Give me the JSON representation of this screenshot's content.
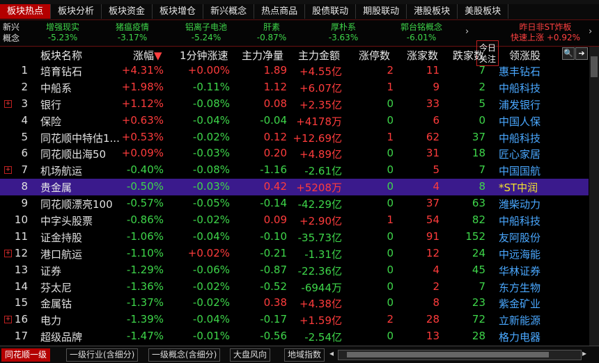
{
  "tabs": [
    {
      "label": "板块热点",
      "active": true
    },
    {
      "label": "板块分析"
    },
    {
      "label": "板块资金"
    },
    {
      "label": "板块增仓"
    },
    {
      "label": "新兴概念"
    },
    {
      "label": "热点商品"
    },
    {
      "label": "股债联动"
    },
    {
      "label": "期股联动"
    },
    {
      "label": "港股板块"
    },
    {
      "label": "美股板块"
    }
  ],
  "concept_bar": {
    "label": "新兴概念",
    "items": [
      {
        "name": "增强现实",
        "pct": "-5.23%"
      },
      {
        "name": "猪瘟疫情",
        "pct": "-3.17%"
      },
      {
        "name": "铝离子电池",
        "pct": "-5.24%"
      },
      {
        "name": "肝素",
        "pct": "-0.87%"
      },
      {
        "name": "厚朴系",
        "pct": "-3.63%"
      },
      {
        "name": "郭台铭概念",
        "pct": "-6.01%"
      }
    ],
    "today_label": "今日关注",
    "st_title": "昨日非ST炸板",
    "st_line": "快速上涨 +0.92%"
  },
  "columns": [
    "板块名称",
    "涨幅",
    "1分钟涨速",
    "主力净量",
    "主力金额",
    "涨停数",
    "涨家数",
    "跌家数",
    "领涨股"
  ],
  "sort_icon": "▼",
  "rows": [
    {
      "idx": "1",
      "name": "培育钻石",
      "pct": "+4.31%",
      "speed": "+0.00%",
      "net": "1.89",
      "amt": "+4.55亿",
      "zt": "2",
      "up": "11",
      "dn": "7",
      "lead": "惠丰钻石",
      "plus": false
    },
    {
      "idx": "2",
      "name": "中船系",
      "pct": "+1.98%",
      "speed": "-0.11%",
      "net": "1.12",
      "amt": "+6.07亿",
      "zt": "1",
      "up": "9",
      "dn": "2",
      "lead": "中船科技",
      "plus": false
    },
    {
      "idx": "3",
      "name": "银行",
      "pct": "+1.12%",
      "speed": "-0.08%",
      "net": "0.08",
      "amt": "+2.35亿",
      "zt": "0",
      "up": "33",
      "dn": "5",
      "lead": "浦发银行",
      "plus": true
    },
    {
      "idx": "4",
      "name": "保险",
      "pct": "+0.63%",
      "speed": "-0.04%",
      "net": "-0.04",
      "amt": "+4178万",
      "zt": "0",
      "up": "6",
      "dn": "0",
      "lead": "中国人保",
      "plus": false
    },
    {
      "idx": "5",
      "name": "同花顺中特估1...",
      "pct": "+0.53%",
      "speed": "-0.02%",
      "net": "0.12",
      "amt": "+12.69亿",
      "zt": "1",
      "up": "62",
      "dn": "37",
      "lead": "中船科技",
      "plus": false
    },
    {
      "idx": "6",
      "name": "同花顺出海50",
      "pct": "+0.09%",
      "speed": "-0.03%",
      "net": "0.20",
      "amt": "+4.89亿",
      "zt": "0",
      "up": "31",
      "dn": "18",
      "lead": "匠心家居",
      "plus": false
    },
    {
      "idx": "7",
      "name": "机场航运",
      "pct": "-0.40%",
      "speed": "-0.08%",
      "net": "-1.16",
      "amt": "-2.61亿",
      "zt": "0",
      "up": "5",
      "dn": "7",
      "lead": "中国国航",
      "plus": true
    },
    {
      "idx": "8",
      "name": "贵金属",
      "pct": "-0.50%",
      "speed": "-0.03%",
      "net": "0.42",
      "amt": "+5208万",
      "zt": "0",
      "up": "4",
      "dn": "8",
      "lead": "*ST中润",
      "plus": false,
      "selected": true
    },
    {
      "idx": "9",
      "name": "同花顺漂亮100",
      "pct": "-0.57%",
      "speed": "-0.05%",
      "net": "-0.14",
      "amt": "-42.29亿",
      "zt": "0",
      "up": "37",
      "dn": "63",
      "lead": "潍柴动力",
      "plus": false
    },
    {
      "idx": "10",
      "name": "中字头股票",
      "pct": "-0.86%",
      "speed": "-0.02%",
      "net": "0.09",
      "amt": "+2.90亿",
      "zt": "1",
      "up": "54",
      "dn": "82",
      "lead": "中船科技",
      "plus": false
    },
    {
      "idx": "11",
      "name": "证金持股",
      "pct": "-1.06%",
      "speed": "-0.04%",
      "net": "-0.10",
      "amt": "-35.73亿",
      "zt": "0",
      "up": "91",
      "dn": "152",
      "lead": "友阿股份",
      "plus": false
    },
    {
      "idx": "12",
      "name": "港口航运",
      "pct": "-1.10%",
      "speed": "+0.02%",
      "net": "-0.21",
      "amt": "-1.31亿",
      "zt": "0",
      "up": "12",
      "dn": "24",
      "lead": "中远海能",
      "plus": true
    },
    {
      "idx": "13",
      "name": "证券",
      "pct": "-1.29%",
      "speed": "-0.06%",
      "net": "-0.87",
      "amt": "-22.36亿",
      "zt": "0",
      "up": "4",
      "dn": "45",
      "lead": "华林证券",
      "plus": false
    },
    {
      "idx": "14",
      "name": "芬太尼",
      "pct": "-1.36%",
      "speed": "-0.02%",
      "net": "-0.52",
      "amt": "-6944万",
      "zt": "0",
      "up": "2",
      "dn": "7",
      "lead": "东方生物",
      "plus": false
    },
    {
      "idx": "15",
      "name": "金属钴",
      "pct": "-1.37%",
      "speed": "-0.02%",
      "net": "0.38",
      "amt": "+4.38亿",
      "zt": "0",
      "up": "8",
      "dn": "23",
      "lead": "紫金矿业",
      "plus": false
    },
    {
      "idx": "16",
      "name": "电力",
      "pct": "-1.39%",
      "speed": "-0.04%",
      "net": "-0.17",
      "amt": "+1.59亿",
      "zt": "2",
      "up": "28",
      "dn": "72",
      "lead": "立新能源",
      "plus": true
    },
    {
      "idx": "17",
      "name": "超级品牌",
      "pct": "-1.47%",
      "speed": "-0.01%",
      "net": "-0.56",
      "amt": "-2.54亿",
      "zt": "0",
      "up": "13",
      "dn": "28",
      "lead": "格力电器",
      "plus": false
    }
  ],
  "bottom_tabs": [
    {
      "label": "同花顺一级",
      "active": true
    },
    {
      "label": "一级行业(含细分)"
    },
    {
      "label": "一级概念(含细分)"
    },
    {
      "label": "大盘风向"
    },
    {
      "label": "地域指数"
    }
  ],
  "colors": {
    "up": "#ff3c3c",
    "down": "#3ed64a",
    "accent": "#b40000",
    "lead": "#4aa8ff",
    "selected": "#3a1a8c"
  }
}
